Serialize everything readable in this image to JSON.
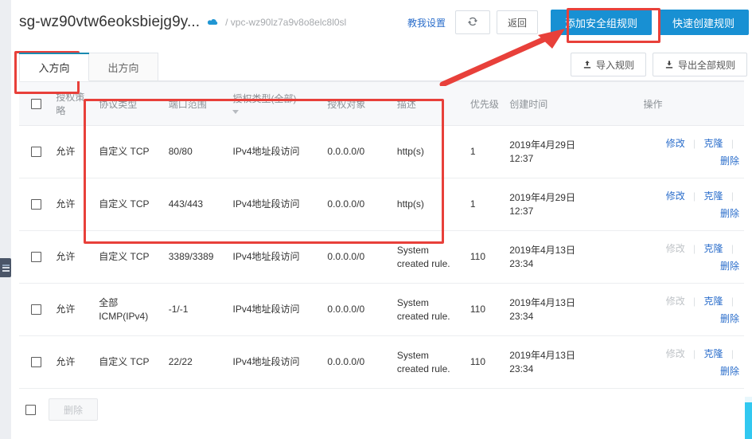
{
  "header": {
    "security_group_name": "sg-wz90vtw6eoksbiejg9y...",
    "cloud_icon": "cloud-icon",
    "breadcrumb_separator": "/",
    "vpc_id": "vpc-wz90lz7a9v8o8elc8l0sl",
    "teach_me_link": "教我设置",
    "refresh_icon": "refresh-icon",
    "back_button": "返回",
    "add_rule_button": "添加安全组规则",
    "quick_create_button": "快速创建规则"
  },
  "tabs": [
    {
      "label": "入方向",
      "active": true
    },
    {
      "label": "出方向",
      "active": false
    }
  ],
  "toolbar": {
    "import_icon": "upload-icon",
    "import_label": "导入规则",
    "export_icon": "download-icon",
    "export_label": "导出全部规则"
  },
  "table": {
    "columns": [
      {
        "key": "check",
        "label": ""
      },
      {
        "key": "policy",
        "label": "授权策略"
      },
      {
        "key": "proto",
        "label": "协议类型"
      },
      {
        "key": "port",
        "label": "端口范围"
      },
      {
        "key": "auth",
        "label": "授权类型(全部)",
        "filter_icon": "chevron-down-icon"
      },
      {
        "key": "target",
        "label": "授权对象"
      },
      {
        "key": "desc",
        "label": "描述"
      },
      {
        "key": "prio",
        "label": "优先级"
      },
      {
        "key": "time",
        "label": "创建时间"
      },
      {
        "key": "ops",
        "label": "操作"
      }
    ],
    "rows": [
      {
        "policy": "允许",
        "proto": "自定义 TCP",
        "port": "80/80",
        "auth": "IPv4地址段访问",
        "target": "0.0.0.0/0",
        "desc": "http(s)",
        "prio": "1",
        "time_date": "2019年4月29日",
        "time_clock": "12:37",
        "op_edit": "修改",
        "op_clone": "克隆",
        "op_delete": "删除",
        "edit_disabled": false
      },
      {
        "policy": "允许",
        "proto": "自定义 TCP",
        "port": "443/443",
        "auth": "IPv4地址段访问",
        "target": "0.0.0.0/0",
        "desc": "http(s)",
        "prio": "1",
        "time_date": "2019年4月29日",
        "time_clock": "12:37",
        "op_edit": "修改",
        "op_clone": "克隆",
        "op_delete": "删除",
        "edit_disabled": false
      },
      {
        "policy": "允许",
        "proto": "自定义 TCP",
        "port": "3389/3389",
        "auth": "IPv4地址段访问",
        "target": "0.0.0.0/0",
        "desc": "System created rule.",
        "prio": "110",
        "time_date": "2019年4月13日",
        "time_clock": "23:34",
        "op_edit": "修改",
        "op_clone": "克隆",
        "op_delete": "删除",
        "edit_disabled": true
      },
      {
        "policy": "允许",
        "proto": "全部 ICMP(IPv4)",
        "port": "-1/-1",
        "auth": "IPv4地址段访问",
        "target": "0.0.0.0/0",
        "desc": "System created rule.",
        "prio": "110",
        "time_date": "2019年4月13日",
        "time_clock": "23:34",
        "op_edit": "修改",
        "op_clone": "克隆",
        "op_delete": "删除",
        "edit_disabled": true
      },
      {
        "policy": "允许",
        "proto": "自定义 TCP",
        "port": "22/22",
        "auth": "IPv4地址段访问",
        "target": "0.0.0.0/0",
        "desc": "System created rule.",
        "prio": "110",
        "time_date": "2019年4月13日",
        "time_clock": "23:34",
        "op_edit": "修改",
        "op_clone": "克隆",
        "op_delete": "删除",
        "edit_disabled": true
      }
    ]
  },
  "footer": {
    "delete_button": "删除"
  },
  "colors": {
    "primary": "#1890d3",
    "link": "#2b6ecb",
    "annotation_red": "#e8403a",
    "tab_active_bar": "#1a8ab0",
    "header_bg": "#f7f8fa"
  }
}
